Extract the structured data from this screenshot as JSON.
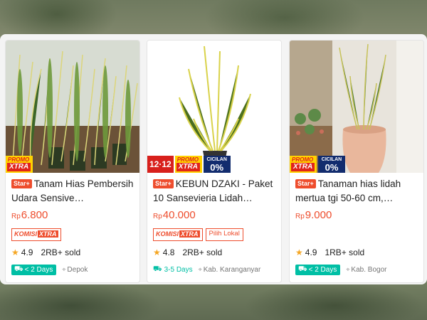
{
  "products": [
    {
      "star_label": "Star+",
      "title": "Tanam Hias Pembersih Udara Sensive…",
      "currency": "Rp",
      "price": "6.800",
      "badges": {
        "promo_top": "PROMO",
        "promo_bottom": "XTRA"
      },
      "komisi": {
        "a": "KOMISI",
        "b": "XTRA"
      },
      "rating": "4.9",
      "sold": "2RB+ sold",
      "ship": "< 2 Days",
      "location": "Depok"
    },
    {
      "star_label": "Star+",
      "title": "KEBUN DZAKI - Paket 10 Sansevieria Lidah…",
      "currency": "Rp",
      "price": "40.000",
      "badges": {
        "sale": "12·12",
        "promo_top": "PROMO",
        "promo_bottom": "XTRA",
        "cicilan_top": "CICILAN",
        "cicilan_bottom": "0%"
      },
      "komisi": {
        "a": "KOMISI",
        "b": "XTRA"
      },
      "local_tag": "Pilih Lokal",
      "rating": "4.8",
      "sold": "2RB+ sold",
      "ship": "3-5 Days",
      "location": "Kab. Karanganyar"
    },
    {
      "star_label": "Star+",
      "title": "Tanaman hias lidah mertua tgi 50-60 cm,…",
      "currency": "Rp",
      "price": "9.000",
      "badges": {
        "promo_top": "PROMO",
        "promo_bottom": "XTRA",
        "cicilan_top": "CICILAN",
        "cicilan_bottom": "0%"
      },
      "rating": "4.9",
      "sold": "1RB+ sold",
      "ship": "< 2 Days",
      "location": "Kab. Bogor"
    }
  ],
  "icons": {
    "star": "star-icon",
    "truck": "truck-icon",
    "pin": "location-pin-icon"
  },
  "colors": {
    "accent": "#ee4d2d",
    "ship": "#00bfa5",
    "star": "#f5a623"
  }
}
